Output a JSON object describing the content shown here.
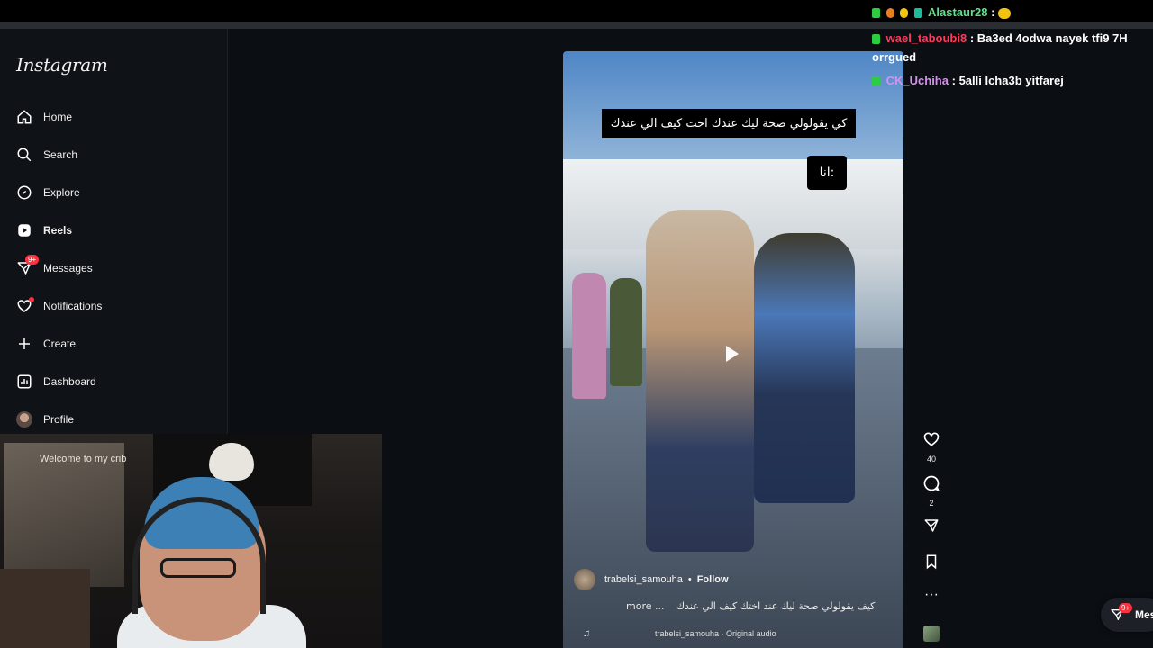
{
  "app": {
    "logo": "Instagram"
  },
  "sidebar": {
    "items": [
      {
        "label": "Home",
        "icon": "home-icon"
      },
      {
        "label": "Search",
        "icon": "search-icon"
      },
      {
        "label": "Explore",
        "icon": "compass-icon"
      },
      {
        "label": "Reels",
        "icon": "reels-icon",
        "active": true
      },
      {
        "label": "Messages",
        "icon": "messenger-icon",
        "badge": "9+"
      },
      {
        "label": "Notifications",
        "icon": "heart-icon",
        "dot": true
      },
      {
        "label": "Create",
        "icon": "plus-icon"
      },
      {
        "label": "Dashboard",
        "icon": "dashboard-icon"
      },
      {
        "label": "Profile",
        "icon": "avatar"
      }
    ]
  },
  "webcam": {
    "poster_text": "Welcome to my crib"
  },
  "reel": {
    "caption_top": "كي يقولولي صحة ليك عندك اخت كيف الي عندك",
    "caption_ana": "انا:",
    "author": "trabelsi_samouha",
    "separator": "•",
    "follow_label": "Follow",
    "description": "كيف يقولولي صحة ليك عند اختك كيف الي عندك",
    "more_label": "more ...",
    "audio": "trabelsi_samouha · Original audio",
    "likes": "40",
    "comments": "2"
  },
  "chat": [
    {
      "user": "Alastaur28",
      "message": "",
      "color": "#63e08a"
    },
    {
      "user": "wael_taboubi8",
      "message": "Ba3ed 4odwa nayek tfi9 7H orrgued",
      "color": "#ff3b5c"
    },
    {
      "user": "CK_Uchiha",
      "message": "5alli lcha3b yitfarej",
      "color": "#d98ff0"
    }
  ],
  "messages_pill": {
    "label": "Mes",
    "badge": "9+"
  },
  "colors": {
    "accent_red": "#ff3040",
    "background": "#0b0e13"
  }
}
